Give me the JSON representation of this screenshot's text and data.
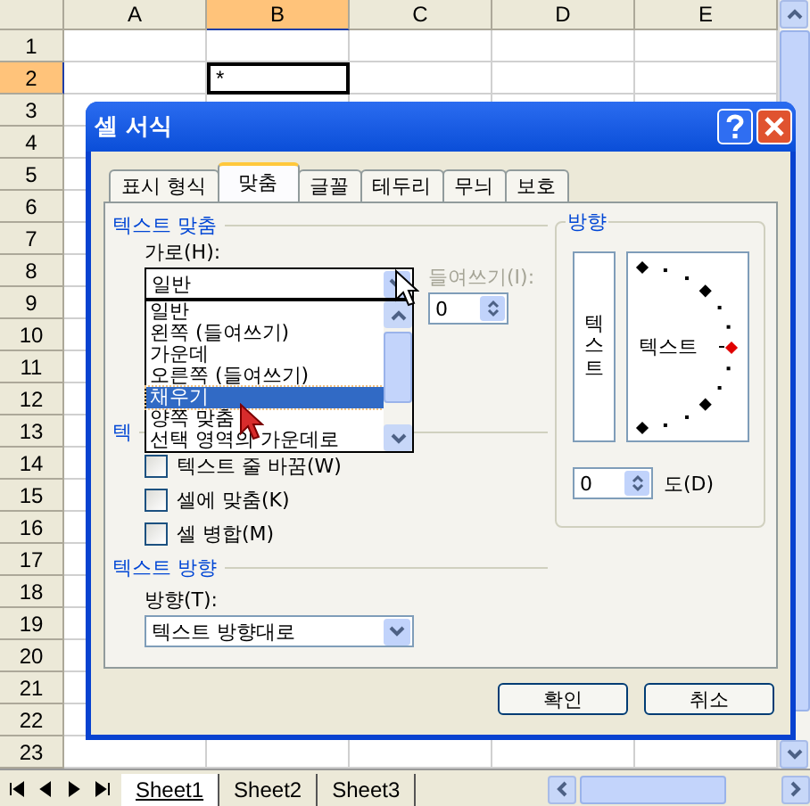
{
  "sheet": {
    "columns": [
      {
        "label": "A",
        "selected": false
      },
      {
        "label": "B",
        "selected": true
      },
      {
        "label": "C",
        "selected": false
      },
      {
        "label": "D",
        "selected": false
      },
      {
        "label": "E",
        "selected": false
      }
    ],
    "rows": [
      {
        "label": "1",
        "selected": false
      },
      {
        "label": "2",
        "selected": true
      },
      {
        "label": "3",
        "selected": false
      },
      {
        "label": "4",
        "selected": false
      },
      {
        "label": "5",
        "selected": false
      },
      {
        "label": "6",
        "selected": false
      },
      {
        "label": "7",
        "selected": false
      },
      {
        "label": "8",
        "selected": false
      },
      {
        "label": "9",
        "selected": false
      },
      {
        "label": "10",
        "selected": false
      },
      {
        "label": "11",
        "selected": false
      },
      {
        "label": "12",
        "selected": false
      },
      {
        "label": "13",
        "selected": false
      },
      {
        "label": "14",
        "selected": false
      },
      {
        "label": "15",
        "selected": false
      },
      {
        "label": "16",
        "selected": false
      },
      {
        "label": "17",
        "selected": false
      },
      {
        "label": "18",
        "selected": false
      },
      {
        "label": "19",
        "selected": false
      },
      {
        "label": "20",
        "selected": false
      },
      {
        "label": "21",
        "selected": false
      },
      {
        "label": "22",
        "selected": false
      },
      {
        "label": "23",
        "selected": false
      }
    ],
    "active_cell": {
      "value": "*"
    },
    "sheet_tabs": [
      {
        "label": "Sheet1",
        "selected": true
      },
      {
        "label": "Sheet2",
        "selected": false
      },
      {
        "label": "Sheet3",
        "selected": false
      }
    ]
  },
  "dialog": {
    "title": "셀 서식",
    "tabs": [
      {
        "label": "표시 형식",
        "selected": false
      },
      {
        "label": "맞춤",
        "selected": true
      },
      {
        "label": "글꼴",
        "selected": false
      },
      {
        "label": "테두리",
        "selected": false
      },
      {
        "label": "무늬",
        "selected": false
      },
      {
        "label": "보호",
        "selected": false
      }
    ],
    "text_alignment": {
      "heading": "텍스트 맞춤",
      "horizontal_label": "가로(H):",
      "horizontal_value": "일반",
      "horizontal_options": [
        {
          "label": "일반",
          "selected": false
        },
        {
          "label": "왼쪽 (들여쓰기)",
          "selected": false
        },
        {
          "label": "가운데",
          "selected": false
        },
        {
          "label": "오른쪽 (들여쓰기)",
          "selected": false
        },
        {
          "label": "채우기",
          "selected": true
        },
        {
          "label": "양쪽 맞춤",
          "selected": false
        },
        {
          "label": "선택 영역의 가운데로",
          "selected": false
        }
      ],
      "indent_label": "들여쓰기(I):",
      "indent_disabled": true,
      "indent_value": "0"
    },
    "text_control": {
      "heading": "텍",
      "options": [
        {
          "label": "텍스트 줄 바꿈(W)",
          "checked": false
        },
        {
          "label": "셀에 맞춤(K)",
          "checked": false
        },
        {
          "label": "셀 병합(M)",
          "checked": false
        }
      ]
    },
    "text_direction": {
      "heading": "텍스트 방향",
      "label": "방향(T):",
      "value": "텍스트 방향대로"
    },
    "orientation": {
      "heading": "방향",
      "vertical_text": "텍스트",
      "dial_text": "텍스트",
      "degrees_value": "0",
      "degrees_label": "도(D)"
    },
    "buttons": [
      "확인",
      "취소"
    ]
  }
}
